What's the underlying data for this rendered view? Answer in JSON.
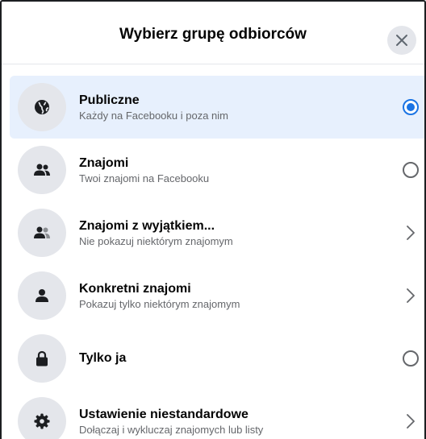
{
  "dialog": {
    "title": "Wybierz grupę odbiorców",
    "close_icon": "close-icon"
  },
  "options": [
    {
      "label": "Publiczne",
      "sub": "Każdy na Facebooku i poza nim",
      "icon": "globe-icon",
      "control": "radio",
      "selected": true
    },
    {
      "label": "Znajomi",
      "sub": "Twoi znajomi na Facebooku",
      "icon": "friends-icon",
      "control": "radio",
      "selected": false
    },
    {
      "label": "Znajomi z wyjątkiem...",
      "sub": "Nie pokazuj niektórym znajomym",
      "icon": "friends-except-icon",
      "control": "chevron",
      "selected": false
    },
    {
      "label": "Konkretni znajomi",
      "sub": "Pokazuj tylko niektórym znajomym",
      "icon": "person-icon",
      "control": "chevron",
      "selected": false
    },
    {
      "label": "Tylko ja",
      "sub": "",
      "icon": "lock-icon",
      "control": "radio",
      "selected": false
    },
    {
      "label": "Ustawienie niestandardowe",
      "sub": "Dołączaj i wykluczaj znajomych lub listy",
      "icon": "gear-icon",
      "control": "chevron",
      "selected": false
    }
  ],
  "colors": {
    "accent": "#1b74e4",
    "selected_bg": "#e7f0fd",
    "icon_bg": "#e4e6eb",
    "text_primary": "#050505",
    "text_secondary": "#65676b"
  }
}
